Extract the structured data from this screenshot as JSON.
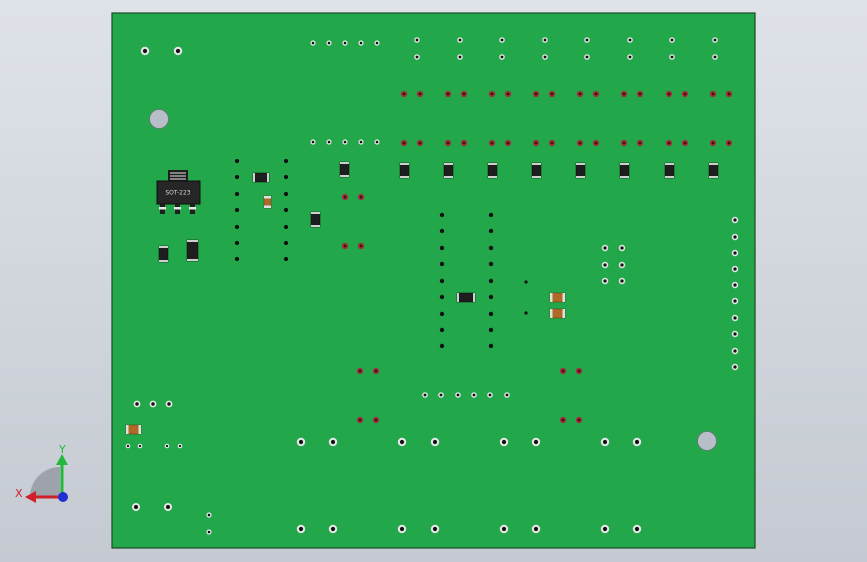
{
  "viewport": {
    "background": "#d8dce2"
  },
  "pcb": {
    "board_color": "#22a84a",
    "board_edge_color": "#1a4a26",
    "ic_package_label": "SOT-223",
    "colors": {
      "pad": "#e6e6e6",
      "hole": "#111111",
      "copper_pad": "#a0303a",
      "smd_dark": "#1e1e1e",
      "smd_cap": "#b06a28",
      "mount_hole": "#b8bec8"
    }
  },
  "triad": {
    "x_label": "X",
    "y_label": "Y",
    "x_color": "#d0202a",
    "y_color": "#22b83a",
    "z_color": "#2030d0"
  }
}
